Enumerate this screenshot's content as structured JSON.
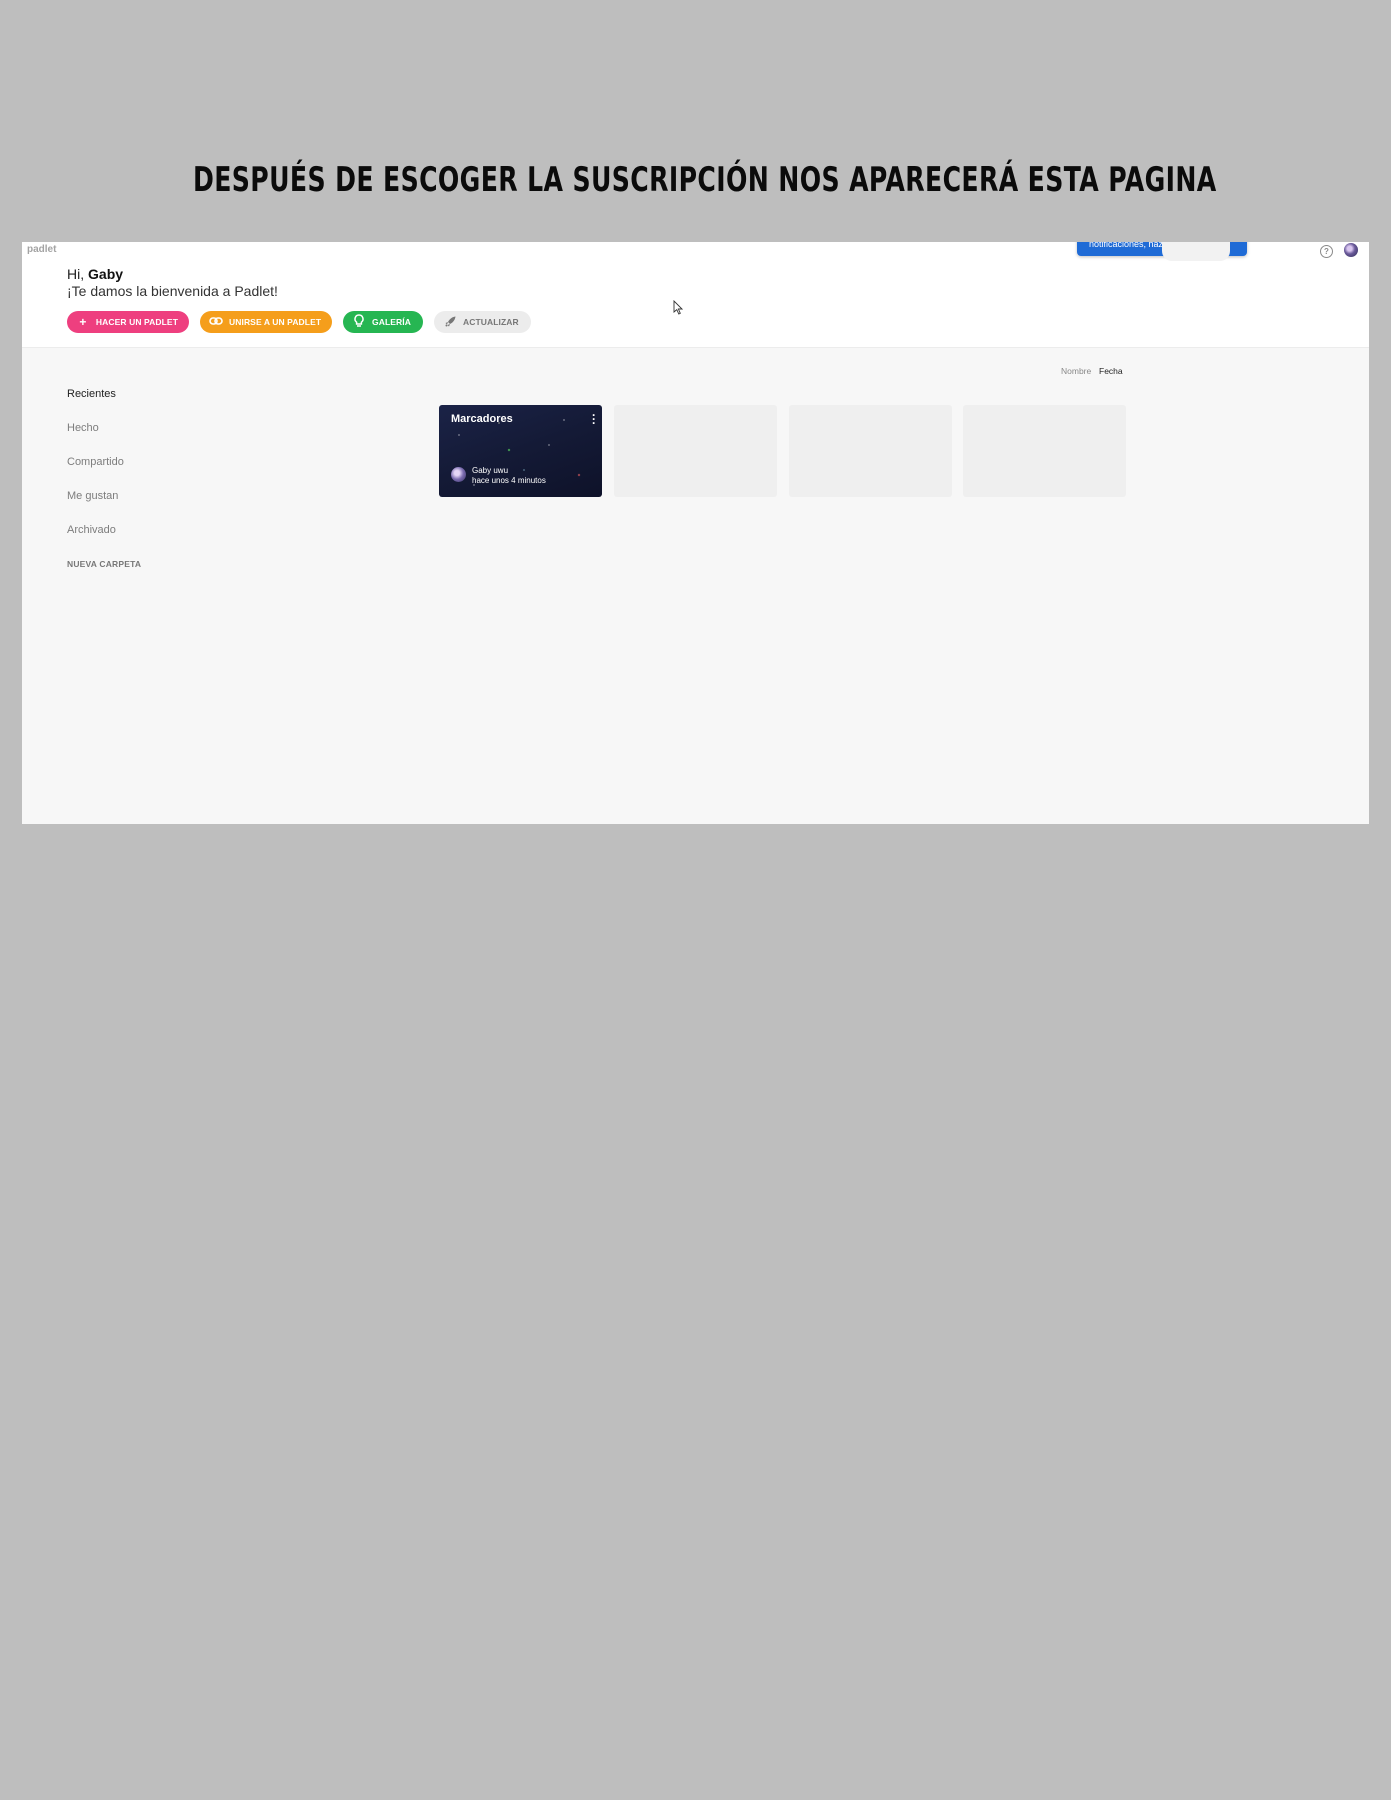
{
  "slide": {
    "title": "Después de escoger la suscripción nos aparecerá esta pagina"
  },
  "app": {
    "logo": "padlet",
    "notification_text": "notificaciones, haz clic aquí.",
    "greeting_prefix": "Hi,",
    "user_name": "Gaby",
    "welcome_message": "¡Te damos la bienvenida a Padlet!"
  },
  "actions": {
    "make_padlet": "HACER UN PADLET",
    "join_padlet": "UNIRSE A UN PADLET",
    "gallery": "GALERÍA",
    "upgrade": "ACTUALIZAR"
  },
  "sort": {
    "by_name": "Nombre",
    "by_date": "Fecha"
  },
  "sidebar": {
    "items": [
      {
        "label": "Recientes"
      },
      {
        "label": "Hecho"
      },
      {
        "label": "Compartido"
      },
      {
        "label": "Me gustan"
      },
      {
        "label": "Archivado"
      }
    ],
    "new_folder": "NUEVA CARPETA"
  },
  "padlets": [
    {
      "title": "Marcadores",
      "author": "Gaby uwu",
      "time": "hace unos 4 minutos"
    }
  ],
  "colors": {
    "make_padlet": "#ee3f7f",
    "join_padlet": "#f59e1b",
    "gallery": "#26b652",
    "upgrade": "#ececec",
    "notification": "#1f6bd6"
  }
}
